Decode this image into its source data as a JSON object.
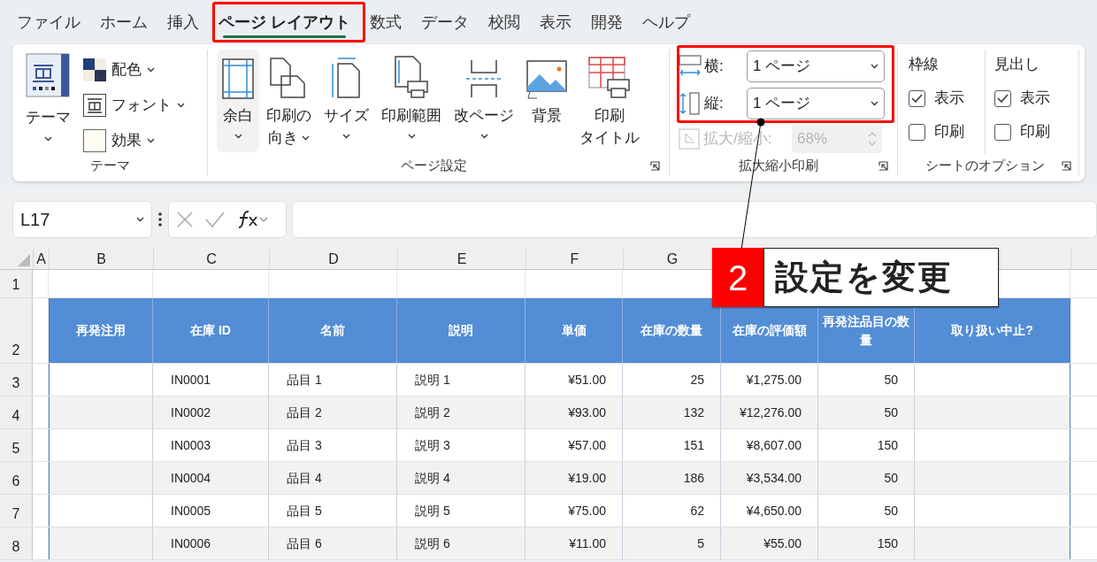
{
  "tabs": [
    {
      "label": "ファイル",
      "selected": false
    },
    {
      "label": "ホーム",
      "selected": false
    },
    {
      "label": "挿入",
      "selected": false
    },
    {
      "label": "ページ レイアウト",
      "selected": true
    },
    {
      "label": "数式",
      "selected": false
    },
    {
      "label": "データ",
      "selected": false
    },
    {
      "label": "校閲",
      "selected": false
    },
    {
      "label": "表示",
      "selected": false
    },
    {
      "label": "開発",
      "selected": false
    },
    {
      "label": "ヘルプ",
      "selected": false
    }
  ],
  "theme_group": {
    "label": "テーマ",
    "button": {
      "lines": [
        "テーマ"
      ],
      "dropdown": true
    },
    "items": [
      {
        "label": "配色"
      },
      {
        "label": "フォント"
      },
      {
        "label": "効果"
      }
    ]
  },
  "page_setup_group": {
    "label": "ページ設定",
    "buttons": [
      {
        "lines": [
          "余白"
        ],
        "dropdown": true,
        "selected": true
      },
      {
        "lines": [
          "印刷の",
          "向き"
        ],
        "dropdown": true,
        "selected": false
      },
      {
        "lines": [
          "サイズ"
        ],
        "dropdown": true,
        "selected": false
      },
      {
        "lines": [
          "印刷範囲"
        ],
        "dropdown": true,
        "selected": false
      },
      {
        "lines": [
          "改ページ"
        ],
        "dropdown": true,
        "selected": false
      },
      {
        "lines": [
          "背景"
        ],
        "dropdown": false,
        "selected": false
      },
      {
        "lines": [
          "印刷",
          "タイトル"
        ],
        "dropdown": false,
        "selected": false
      }
    ]
  },
  "scale_group": {
    "label": "拡大縮小印刷",
    "fits": [
      {
        "label": "横:",
        "value": "1 ページ"
      },
      {
        "label": "縦:",
        "value": "1 ページ"
      }
    ],
    "scale": {
      "label": "拡大/縮小:",
      "value": "68%",
      "disabled": true
    }
  },
  "sheet_options_group": {
    "label": "シートのオプション",
    "columns": [
      {
        "title": "枠線",
        "options": [
          {
            "label": "表示",
            "checked": true
          },
          {
            "label": "印刷",
            "checked": false
          }
        ]
      },
      {
        "title": "見出し",
        "options": [
          {
            "label": "表示",
            "checked": true
          },
          {
            "label": "印刷",
            "checked": false
          }
        ]
      }
    ]
  },
  "formula_bar": {
    "name_box": "L17"
  },
  "sheet": {
    "column_headers": [
      "A",
      "B",
      "C",
      "D",
      "E",
      "F",
      "G"
    ],
    "row_numbers": [
      "1",
      "2",
      "3",
      "4",
      "5",
      "6",
      "7",
      "8"
    ],
    "table_headers": [
      "再発注用",
      "在庫 ID",
      "名前",
      "説明",
      "単価",
      "在庫の数量",
      "在庫の評価額",
      "再発注品目の数量",
      "取り扱い中止?"
    ],
    "rows": [
      [
        "",
        "IN0001",
        "品目 1",
        "説明 1",
        "¥51.00",
        "25",
        "¥1,275.00",
        "50",
        ""
      ],
      [
        "",
        "IN0002",
        "品目 2",
        "説明 2",
        "¥93.00",
        "132",
        "¥12,276.00",
        "50",
        ""
      ],
      [
        "",
        "IN0003",
        "品目 3",
        "説明 3",
        "¥57.00",
        "151",
        "¥8,607.00",
        "150",
        ""
      ],
      [
        "",
        "IN0004",
        "品目 4",
        "説明 4",
        "¥19.00",
        "186",
        "¥3,534.00",
        "50",
        ""
      ],
      [
        "",
        "IN0005",
        "品目 5",
        "説明 5",
        "¥75.00",
        "62",
        "¥4,650.00",
        "50",
        ""
      ],
      [
        "",
        "IN0006",
        "品目 6",
        "説明 6",
        "¥11.00",
        "5",
        "¥55.00",
        "150",
        ""
      ]
    ]
  },
  "callout": {
    "number": "2",
    "text": "設定を変更"
  }
}
